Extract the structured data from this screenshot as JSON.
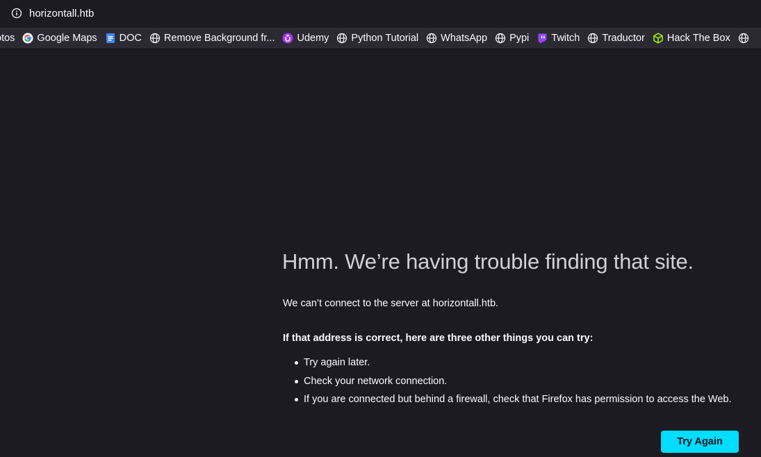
{
  "urlbar": {
    "url": "horizontall.htb"
  },
  "bookmarks": [
    {
      "label": "otos",
      "icon": "none"
    },
    {
      "label": "Google Maps",
      "icon": "google-icon"
    },
    {
      "label": "DOC",
      "icon": "docs-icon"
    },
    {
      "label": "Remove Background fr...",
      "icon": "globe-icon"
    },
    {
      "label": "Udemy",
      "icon": "udemy-icon"
    },
    {
      "label": "Python Tutorial",
      "icon": "globe-icon"
    },
    {
      "label": "WhatsApp",
      "icon": "globe-icon"
    },
    {
      "label": "Pypi",
      "icon": "globe-icon"
    },
    {
      "label": "Twitch",
      "icon": "twitch-icon"
    },
    {
      "label": "Traductor",
      "icon": "globe-icon"
    },
    {
      "label": "Hack The Box",
      "icon": "htb-icon"
    },
    {
      "label": "",
      "icon": "globe-icon"
    }
  ],
  "error": {
    "title": "Hmm. We’re having trouble finding that site.",
    "description": "We can’t connect to the server at horizontall.htb.",
    "tips_heading": "If that address is correct, here are three other things you can try:",
    "tips": [
      "Try again later.",
      "Check your network connection.",
      "If you are connected but behind a firewall, check that Firefox has permission to access the Web."
    ],
    "button_label": "Try Again"
  },
  "colors": {
    "background": "#1c1b22",
    "toolbar": "#2b2a33",
    "accent": "#00ddff"
  }
}
